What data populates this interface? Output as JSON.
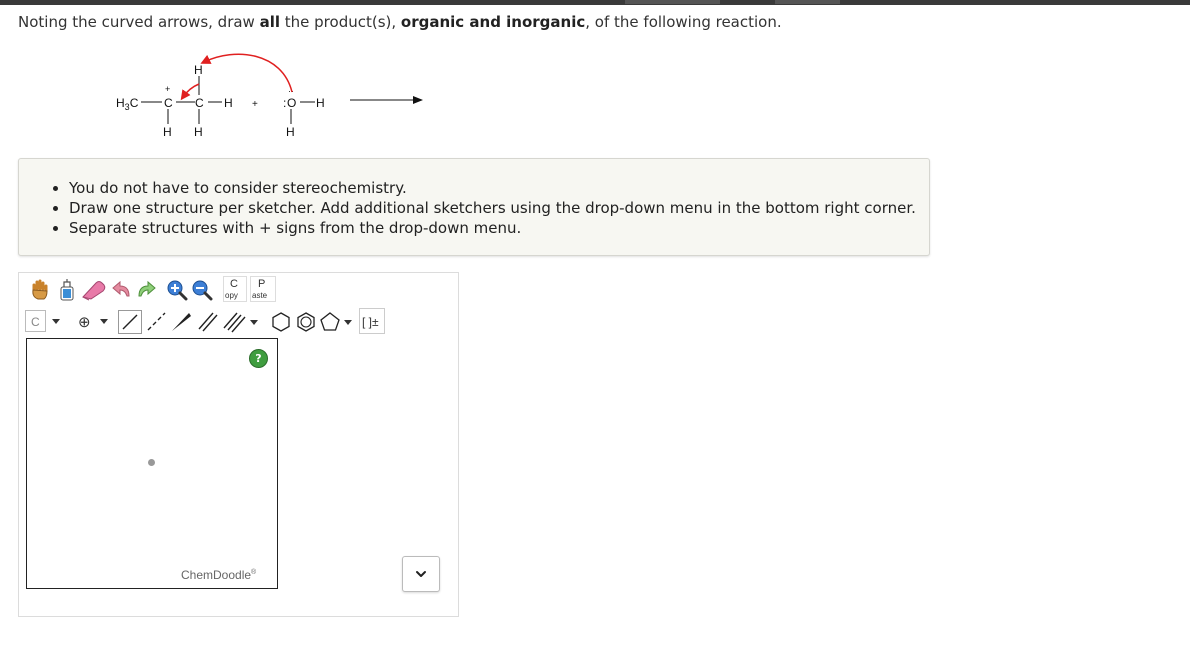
{
  "question": {
    "prefix": "Noting the curved arrows, draw ",
    "all": "all",
    "middle": " the product(s), ",
    "emph": "organic and inorganic",
    "suffix": ", of the following reaction."
  },
  "reaction": {
    "carbocation_atom": "C",
    "charge": "+",
    "methyl": "H3C",
    "h_top": "H",
    "h_bottom_left": "H",
    "h_bottom_right": "H",
    "carbon2": "C",
    "h_right": "H",
    "plus": "+",
    "water_o": "O",
    "water_h_right": "H",
    "water_h_bottom": "H",
    "arrow_color": "#e02020"
  },
  "instructions": [
    "You do not have to consider stereochemistry.",
    "Draw one structure per sketcher. Add additional sketchers using the drop-down menu in the bottom right corner.",
    "Separate structures with + signs from the drop-down menu."
  ],
  "toolbar": {
    "copy_top": "C",
    "copy_bottom": "opy",
    "paste_top": "P",
    "paste_bottom": "aste",
    "element_label": "C",
    "charge_label": "⊕",
    "template_label": "[ ]±"
  },
  "canvas": {
    "help_label": "?",
    "brand": "ChemDoodle",
    "brand_mark": "®"
  },
  "sketcher_dropdown": {
    "icon": "chevron-down-icon"
  }
}
